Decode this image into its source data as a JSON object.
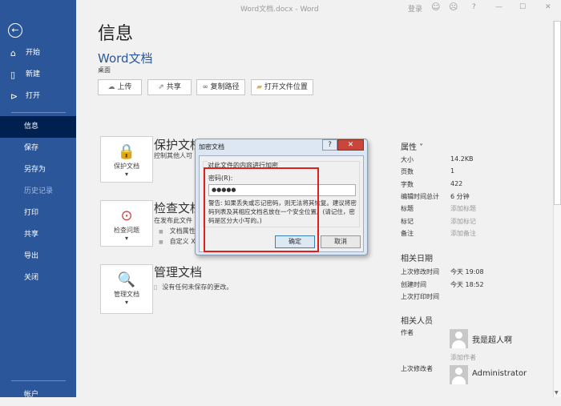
{
  "titlebar": {
    "title": "Word文档.docx  -  Word",
    "login": "登录",
    "help": "?",
    "minimize": "—",
    "maximize": "☐",
    "close": "✕"
  },
  "sidebar": {
    "items": [
      {
        "label": "开始",
        "icon": "home-icon"
      },
      {
        "label": "新建",
        "icon": "new-doc-icon"
      },
      {
        "label": "打开",
        "icon": "open-folder-icon"
      },
      {
        "label": "信息"
      },
      {
        "label": "保存"
      },
      {
        "label": "另存为"
      },
      {
        "label": "历史记录"
      },
      {
        "label": "打印"
      },
      {
        "label": "共享"
      },
      {
        "label": "导出"
      },
      {
        "label": "关闭"
      },
      {
        "label": "帐户"
      }
    ]
  },
  "page": {
    "title": "信息",
    "doc_name": "Word文档",
    "location": "桌面",
    "buttons": {
      "upload": "上传",
      "share": "共享",
      "copy_path": "复制路径",
      "open_location": "打开文件位置"
    }
  },
  "protect": {
    "button": "保护文档",
    "title": "保护文档",
    "desc": "控制其他人可"
  },
  "inspect": {
    "button": "检查问题",
    "title": "检查文档",
    "desc": "在发布此文件",
    "bullets": [
      "文档属性",
      "自定义 X"
    ]
  },
  "manage": {
    "button": "管理文档",
    "title": "管理文档",
    "desc": "没有任何未保存的更改。"
  },
  "dialog": {
    "title": "加密文档",
    "help": "?",
    "close": "✕",
    "group": "对此文件的内容进行加密",
    "label": "密码(R):",
    "password": "●●●●●",
    "warning": "警告: 如果丢失或忘记密码，则无法将其恢复。建议将密码列表及其相应文档名放在一个安全位置。(请记住，密码是区分大小写的。)",
    "ok": "确定",
    "cancel": "取消",
    "highlight_color": "#e0201c"
  },
  "properties": {
    "title": "属性 ˅",
    "rows": [
      {
        "label": "大小",
        "value": "14.2KB"
      },
      {
        "label": "页数",
        "value": "1"
      },
      {
        "label": "字数",
        "value": "422"
      },
      {
        "label": "编辑时间总计",
        "value": "6 分钟"
      },
      {
        "label": "标题",
        "value": "添加标题"
      },
      {
        "label": "标记",
        "value": "添加标记"
      },
      {
        "label": "备注",
        "value": "添加备注"
      }
    ]
  },
  "dates": {
    "title": "相关日期",
    "rows": [
      {
        "label": "上次修改时间",
        "value": "今天 19:08"
      },
      {
        "label": "创建时间",
        "value": "今天 18:52"
      },
      {
        "label": "上次打印时间",
        "value": ""
      }
    ]
  },
  "people": {
    "title": "相关人员",
    "author_label": "作者",
    "author": "我是超人啊",
    "add_author": "添加作者",
    "modifier_label": "上次修改者",
    "modifier": "Administrator"
  },
  "colors": {
    "sidebar": "#2b579a",
    "selected": "#002050",
    "accent": "#2b579a"
  }
}
